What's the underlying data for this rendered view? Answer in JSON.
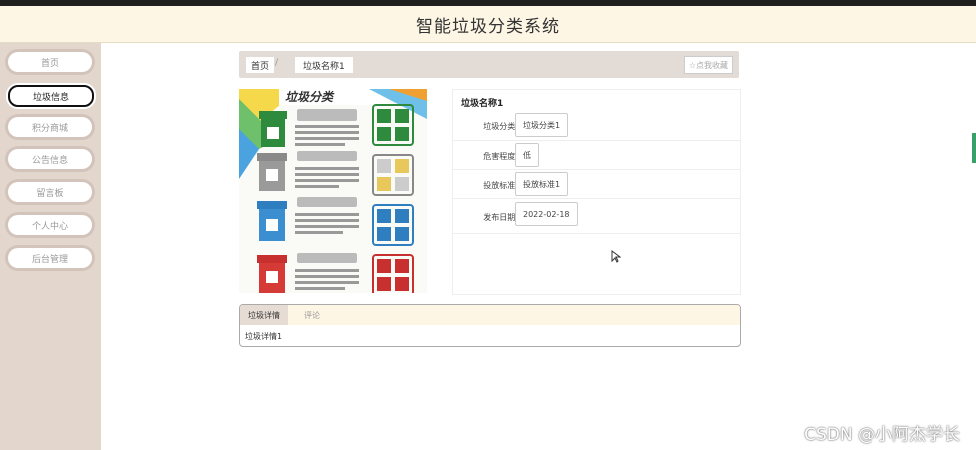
{
  "header": {
    "title": "智能垃圾分类系统"
  },
  "sidebar": {
    "items": [
      {
        "label": "首页"
      },
      {
        "label": "垃圾信息"
      },
      {
        "label": "积分商城"
      },
      {
        "label": "公告信息"
      },
      {
        "label": "留言板"
      },
      {
        "label": "个人中心"
      },
      {
        "label": "后台管理"
      }
    ],
    "active_index": 1
  },
  "breadcrumb": {
    "home": "首页",
    "separator": "/",
    "current": "垃圾名称1",
    "favorite_label": "☆点我收藏"
  },
  "detail": {
    "title": "垃圾名称1",
    "fields": [
      {
        "label": "垃圾分类:",
        "value": "垃圾分类1"
      },
      {
        "label": "危害程度:",
        "value": "低"
      },
      {
        "label": "投放标准:",
        "value": "投放标准1"
      },
      {
        "label": "发布日期:",
        "value": "2022-02-18"
      }
    ]
  },
  "poster": {
    "heading": "垃圾分类",
    "bin_colors": [
      "#2e8b3e",
      "#8a8a8a",
      "#2f7fc0",
      "#c7302e"
    ]
  },
  "tabs": {
    "items": [
      {
        "label": "垃圾详情"
      },
      {
        "label": "评论"
      }
    ],
    "active_content": "垃圾详情1"
  },
  "watermark": "CSDN @小阿杰学长"
}
